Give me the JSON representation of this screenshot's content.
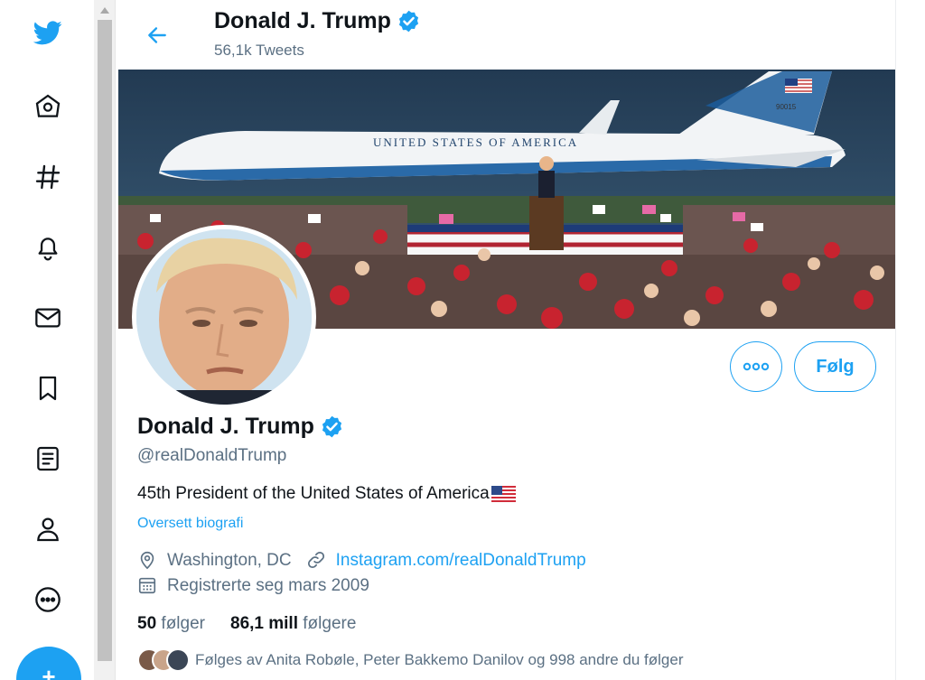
{
  "nav": {
    "items": [
      {
        "icon": "twitter-logo-icon"
      },
      {
        "icon": "home-icon"
      },
      {
        "icon": "explore-hashtag-icon"
      },
      {
        "icon": "notifications-bell-icon"
      },
      {
        "icon": "messages-envelope-icon"
      },
      {
        "icon": "bookmark-icon"
      },
      {
        "icon": "lists-icon"
      },
      {
        "icon": "profile-icon"
      },
      {
        "icon": "more-circle-icon"
      }
    ],
    "tweet_button_icon": "compose-tweet-icon",
    "tweet_button_label": "+"
  },
  "header": {
    "name": "Donald J. Trump",
    "tweet_count": "56,1k Tweets"
  },
  "profile": {
    "name": "Donald J. Trump",
    "handle": "@realDonaldTrump",
    "bio": "45th President of the United States of America",
    "translate_bio": "Oversett biografi",
    "location": "Washington, DC",
    "website": "Instagram.com/realDonaldTrump",
    "joined": "Registrerte seg mars 2009",
    "following_count": "50",
    "following_label": "følger",
    "followers_count": "86,1 mill",
    "followers_label": "følgere",
    "followed_by": "Følges av Anita Robøle, Peter Bakkemo Danilov og 998 andre du følger",
    "follow_button": "Følg",
    "more_button_icon": "more-options-icon"
  },
  "banner": {
    "plane_text": "UNITED STATES OF AMERICA",
    "tail_number": "90015"
  },
  "colors": {
    "accent": "#1da1f2",
    "text": "#0f1419",
    "secondary": "#5b7083"
  }
}
